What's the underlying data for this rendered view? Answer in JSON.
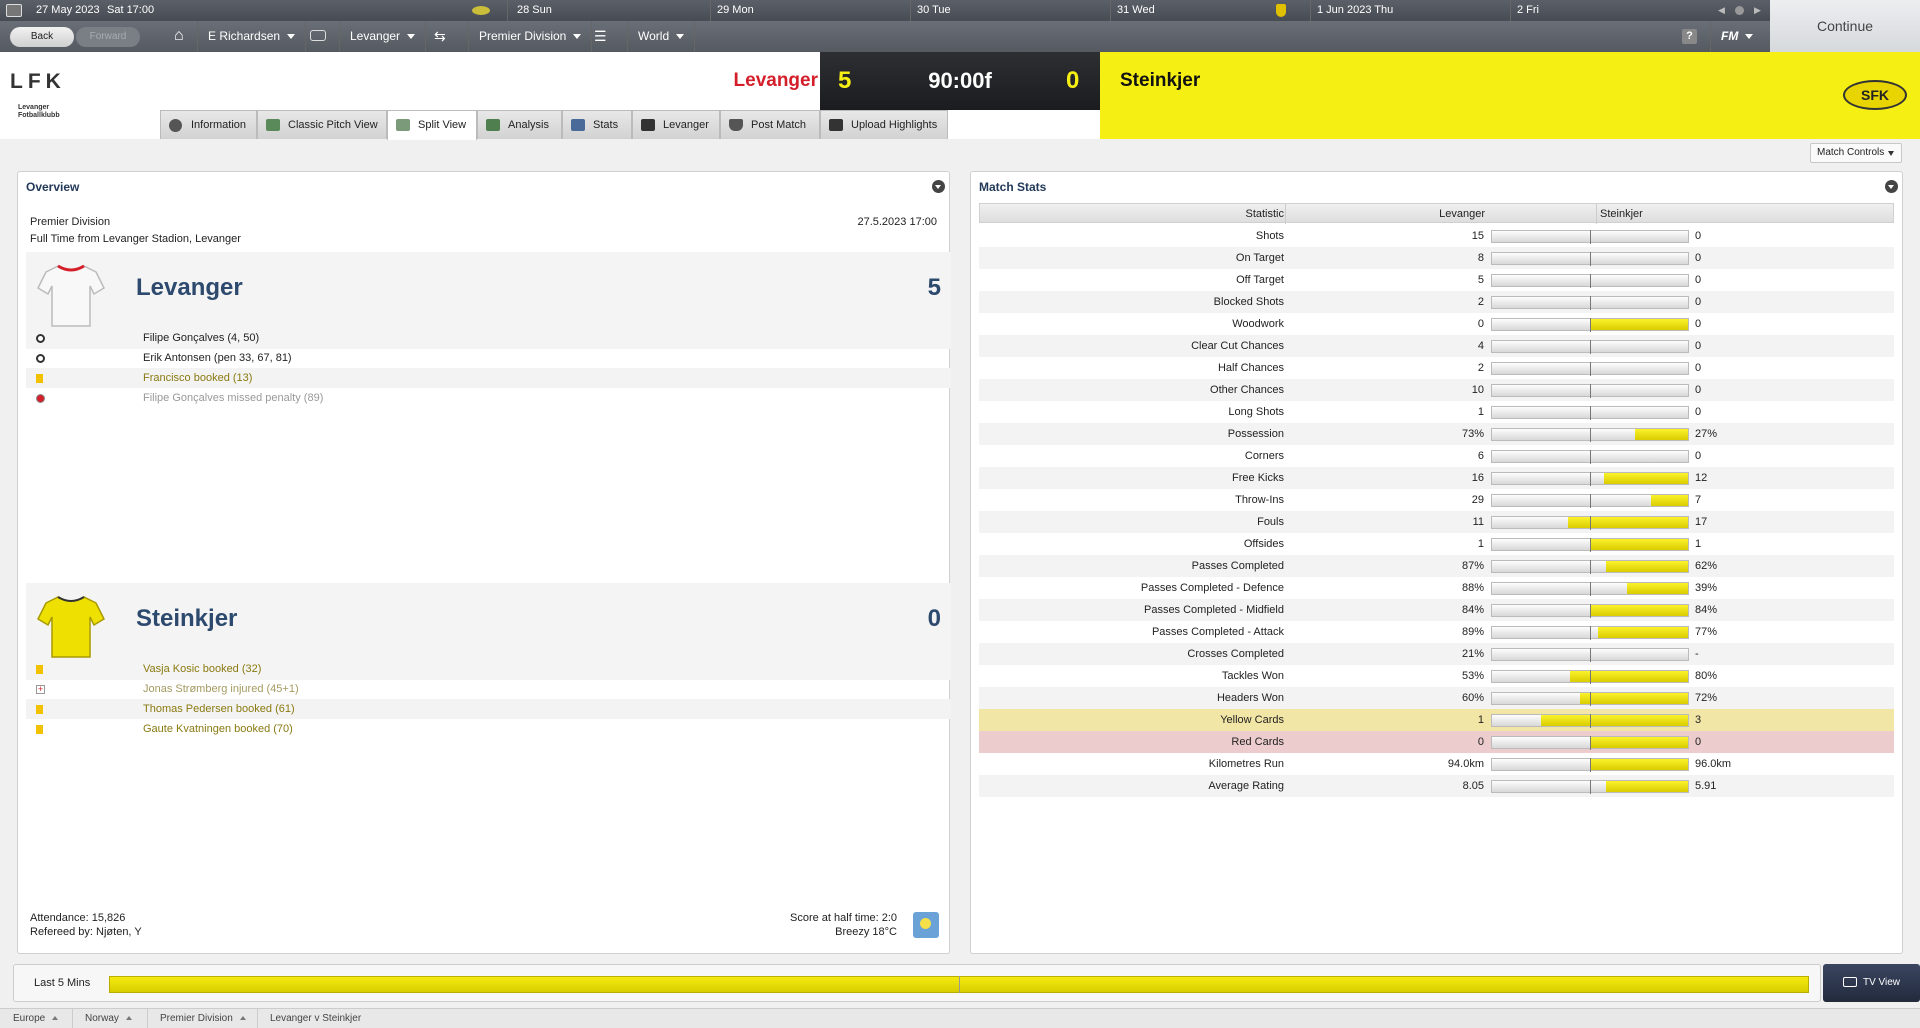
{
  "topbar": {
    "date": "27 May 2023",
    "day_time": "Sat  17:00",
    "calendar": [
      {
        "label": "28 Sun"
      },
      {
        "label": "29 Mon"
      },
      {
        "label": "30 Tue"
      },
      {
        "label": "31 Wed"
      },
      {
        "label": "1 Jun 2023  Thu"
      },
      {
        "label": "2 Fri"
      }
    ]
  },
  "nav": {
    "back": "Back",
    "forward": "Forward",
    "manager": "E Richardsen",
    "club": "Levanger",
    "competition": "Premier Division",
    "world": "World",
    "fm": "FM",
    "continue": "Continue"
  },
  "match": {
    "home_team": "Levanger",
    "away_team": "Steinkjer",
    "home_score": "5",
    "away_score": "0",
    "clock": "90:00f",
    "home_logo": "LFK",
    "home_logo_sub": "Levanger Fotballklubb",
    "away_logo": "SFK",
    "home_color": "#d41f2b",
    "away_color": "#f6ef14"
  },
  "tabs": [
    {
      "label": "Information",
      "icon": "info-icon"
    },
    {
      "label": "Classic Pitch View",
      "icon": "pitch-icon"
    },
    {
      "label": "Split View",
      "icon": "split-view-icon"
    },
    {
      "label": "Analysis",
      "icon": "analysis-icon"
    },
    {
      "label": "Stats",
      "icon": "stats-icon"
    },
    {
      "label": "Levanger",
      "icon": "team-icon"
    },
    {
      "label": "Post Match",
      "icon": "shield-icon"
    },
    {
      "label": "Upload Highlights",
      "icon": "camera-icon"
    }
  ],
  "match_controls": "Match Controls",
  "overview": {
    "title": "Overview",
    "competition": "Premier Division",
    "venue": "Full Time from Levanger Stadion, Levanger",
    "date": "27.5.2023 17:00",
    "home_events": [
      {
        "icon": "goal-icon",
        "text": "Filipe Gonçalves (4, 50)"
      },
      {
        "icon": "goal-icon",
        "text": "Erik Antonsen (pen 33, 67, 81)"
      },
      {
        "icon": "yellow-card-icon",
        "text": "Francisco booked (13)"
      },
      {
        "icon": "missed-penalty-icon",
        "text": "Filipe Gonçalves missed penalty (89)"
      }
    ],
    "away_events": [
      {
        "icon": "yellow-card-icon",
        "text": "Vasja Kosic booked (32)"
      },
      {
        "icon": "injury-icon",
        "text": "Jonas Strømberg injured (45+1)"
      },
      {
        "icon": "yellow-card-icon",
        "text": "Thomas Pedersen booked (61)"
      },
      {
        "icon": "yellow-card-icon",
        "text": "Gaute Kvatningen booked (70)"
      }
    ],
    "attendance": "Attendance: 15,826",
    "referee": "Refereed by: Njøten, Y",
    "half_time": "Score at half time: 2:0",
    "weather": "Breezy 18°C"
  },
  "stats": {
    "title": "Match Stats",
    "col_stat": "Statistic",
    "col_home": "Levanger",
    "col_away": "Steinkjer",
    "rows": [
      {
        "label": "Shots",
        "home": "15",
        "away": "0",
        "share": 1.0
      },
      {
        "label": "On Target",
        "home": "8",
        "away": "0",
        "share": 1.0
      },
      {
        "label": "Off Target",
        "home": "5",
        "away": "0",
        "share": 1.0
      },
      {
        "label": "Blocked Shots",
        "home": "2",
        "away": "0",
        "share": 1.0
      },
      {
        "label": "Woodwork",
        "home": "0",
        "away": "0",
        "share": 0.5
      },
      {
        "label": "Clear Cut Chances",
        "home": "4",
        "away": "0",
        "share": 1.0
      },
      {
        "label": "Half Chances",
        "home": "2",
        "away": "0",
        "share": 1.0
      },
      {
        "label": "Other Chances",
        "home": "10",
        "away": "0",
        "share": 1.0
      },
      {
        "label": "Long Shots",
        "home": "1",
        "away": "0",
        "share": 1.0
      },
      {
        "label": "Possession",
        "home": "73%",
        "away": "27%",
        "share": 0.73
      },
      {
        "label": "Corners",
        "home": "6",
        "away": "0",
        "share": 1.0
      },
      {
        "label": "Free Kicks",
        "home": "16",
        "away": "12",
        "share": 0.57
      },
      {
        "label": "Throw-Ins",
        "home": "29",
        "away": "7",
        "share": 0.81
      },
      {
        "label": "Fouls",
        "home": "11",
        "away": "17",
        "share": 0.39
      },
      {
        "label": "Offsides",
        "home": "1",
        "away": "1",
        "share": 0.5
      },
      {
        "label": "Passes Completed",
        "home": "87%",
        "away": "62%",
        "share": 0.58
      },
      {
        "label": "Passes Completed - Defence",
        "home": "88%",
        "away": "39%",
        "share": 0.69
      },
      {
        "label": "Passes Completed - Midfield",
        "home": "84%",
        "away": "84%",
        "share": 0.5
      },
      {
        "label": "Passes Completed - Attack",
        "home": "89%",
        "away": "77%",
        "share": 0.54
      },
      {
        "label": "Crosses Completed",
        "home": "21%",
        "away": "-",
        "share": 1.0
      },
      {
        "label": "Tackles Won",
        "home": "53%",
        "away": "80%",
        "share": 0.4
      },
      {
        "label": "Headers Won",
        "home": "60%",
        "away": "72%",
        "share": 0.45
      },
      {
        "label": "Yellow Cards",
        "home": "1",
        "away": "3",
        "share": 0.25,
        "highlight": "#f2e6a6"
      },
      {
        "label": "Red Cards",
        "home": "0",
        "away": "0",
        "share": 0.5,
        "highlight": "#eccccc"
      },
      {
        "label": "Kilometres Run",
        "home": "94.0km",
        "away": "96.0km",
        "share": 0.5
      },
      {
        "label": "Average Rating",
        "home": "8.05",
        "away": "5.91",
        "share": 0.58
      }
    ]
  },
  "bottom": {
    "last5": "Last 5 Mins",
    "tv_view": "TV View"
  },
  "breadcrumbs": [
    "Europe",
    "Norway",
    "Premier Division",
    "Levanger v Steinkjer"
  ]
}
